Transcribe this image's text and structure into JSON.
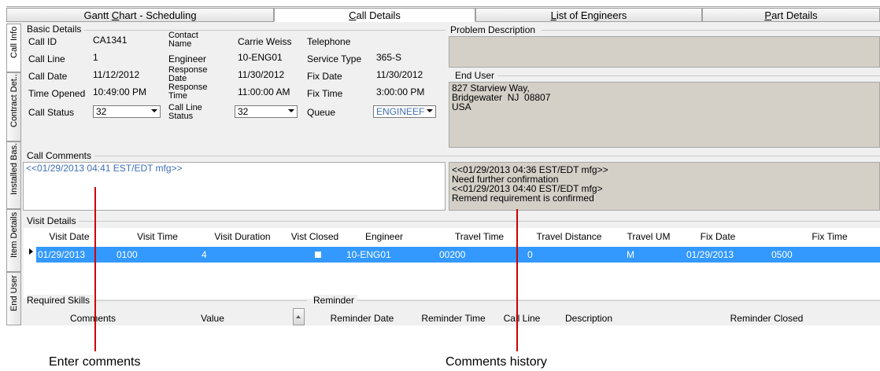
{
  "colors": {
    "accent": "#3399ff",
    "annotation_line": "#cc0000",
    "panel_grey": "#d4d0c8",
    "link_blue": "#3f6fb8"
  },
  "top_tabs": [
    {
      "label": "Gantt Chart - Scheduling",
      "active": false
    },
    {
      "label": "Call Details",
      "active": true
    },
    {
      "label": "List of Engineers",
      "active": false
    },
    {
      "label": "Part Details",
      "active": false
    }
  ],
  "side_tabs": [
    {
      "label": "Call Info",
      "active": true
    },
    {
      "label": "Contract Det...",
      "active": false
    },
    {
      "label": "Installed Bas...",
      "active": false
    },
    {
      "label": "Item Details",
      "active": false
    },
    {
      "label": "End User De...",
      "active": false
    }
  ],
  "basic_details": {
    "title": "Basic Details",
    "call_id_label": "Call ID",
    "call_id": "CA1341",
    "call_line_label": "Call Line",
    "call_line": "1",
    "call_date_label": "Call Date",
    "call_date": "11/12/2012",
    "time_opened_label": "Time Opened",
    "time_opened": "10:49:00 PM",
    "call_status_label": "Call Status",
    "call_status": "32",
    "contact_name_label": "Contact Name",
    "contact_name": "Carrie Weiss",
    "engineer_label": "Engineer",
    "engineer": "10-ENG01",
    "response_date_label": "Response Date",
    "response_date": "11/30/2012",
    "response_time_label": "Response Time",
    "response_time": "11:00:00 AM",
    "call_line_status_label": "Call Line Status",
    "call_line_status": "32",
    "telephone_label": "Telephone",
    "telephone": "",
    "service_type_label": "Service Type",
    "service_type": "365-S",
    "fix_date_label": "Fix Date",
    "fix_date": "11/30/2012",
    "fix_time_label": "Fix Time",
    "fix_time": "3:00:00 PM",
    "queue_label": "Queue",
    "queue": "ENGINEEF"
  },
  "problem_description": {
    "title": "Problem Description",
    "text": ""
  },
  "end_user": {
    "title": "End User",
    "text": "827 Starview Way,\nBridgewater  NJ  08807\nUSA"
  },
  "call_comments": {
    "title": "Call Comments",
    "entry": "<<01/29/2013 04:41 EST/EDT mfg>>",
    "history": "<<01/29/2013 04:36 EST/EDT mfg>>\nNeed further confirmation\n<<01/29/2013 04:40 EST/EDT mfg>\nRemend requirement is confirmed"
  },
  "visit_details": {
    "title": "Visit Details",
    "columns": [
      "Visit Date",
      "Visit Time",
      "Visit Duration",
      "Vist Closed",
      "Engineer",
      "Travel Time",
      "Travel Distance",
      "Travel UM",
      "Fix Date",
      "Fix Time"
    ],
    "rows": [
      {
        "visit_date": "01/29/2013",
        "visit_time": "0100",
        "visit_duration": "4",
        "visit_closed": false,
        "engineer": "10-ENG01",
        "travel_time": "00200",
        "travel_distance": "0",
        "travel_um": "M",
        "fix_date": "01/29/2013",
        "fix_time": "0500"
      }
    ]
  },
  "required_skills": {
    "title": "Required Skills",
    "columns": [
      "Comments",
      "Value"
    ]
  },
  "reminder": {
    "title": "Reminder",
    "columns": [
      "Reminder Date",
      "Reminder Time",
      "Call Line",
      "Description",
      "Reminder Closed"
    ]
  },
  "annotations": {
    "left": "Enter comments",
    "right": "Comments history"
  }
}
